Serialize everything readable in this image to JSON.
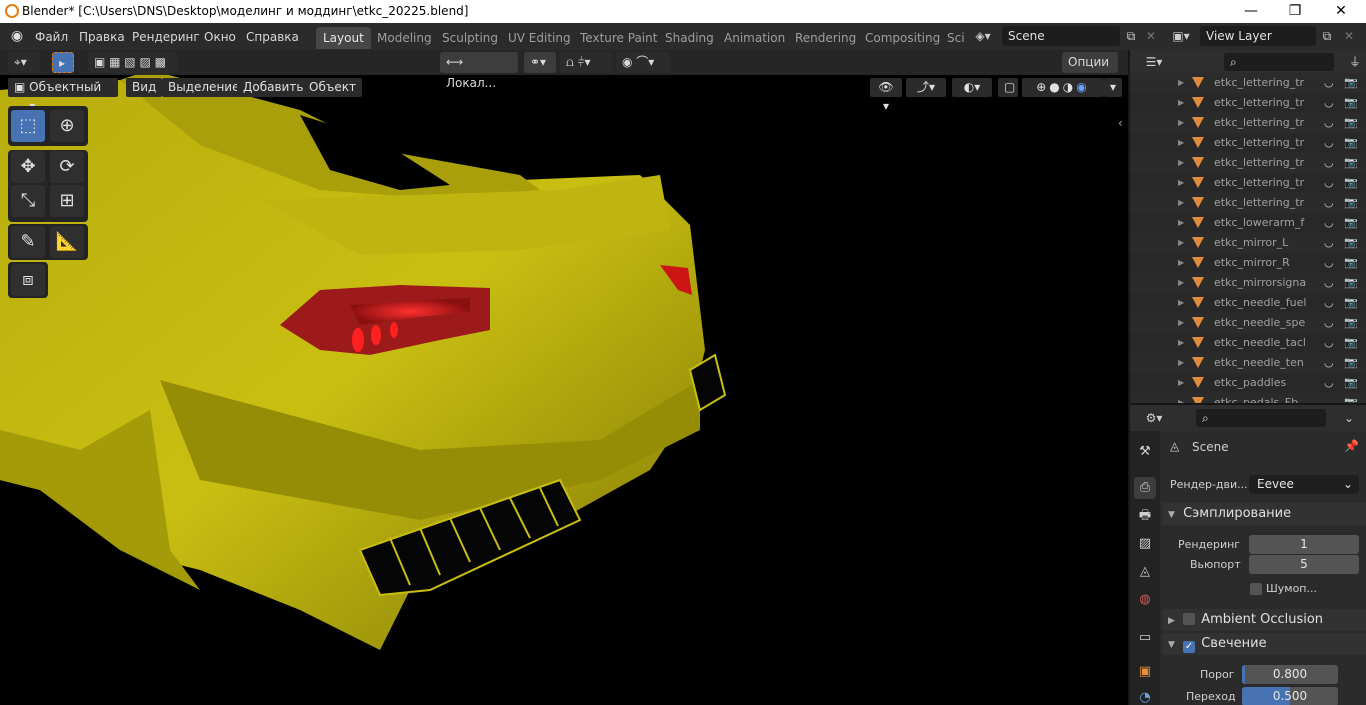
{
  "window": {
    "title": "Blender* [C:\\Users\\DNS\\Desktop\\моделинг и моддинг\\etkc_20225.blend]",
    "minimize": "—",
    "maximize": "❐",
    "close": "✕"
  },
  "menu": {
    "items": [
      "Файл",
      "Правка",
      "Рендеринг",
      "Окно",
      "Справка"
    ]
  },
  "workspaces": {
    "tabs": [
      "Layout",
      "Modeling",
      "Sculpting",
      "UV Editing",
      "Texture Paint",
      "Shading",
      "Animation",
      "Rendering",
      "Compositing",
      "Sci"
    ],
    "active": "Layout"
  },
  "scene": {
    "name": "Scene"
  },
  "view_layer": {
    "name": "View Layer"
  },
  "viewport": {
    "mode": "Объектный ...",
    "menus": [
      "Вид",
      "Выделение",
      "Добавить",
      "Объект"
    ],
    "transform": "Локал...",
    "options": "Опции"
  },
  "outliner": {
    "items": [
      "etkc_lettering_tr",
      "etkc_lettering_tr",
      "etkc_lettering_tr",
      "etkc_lettering_tr",
      "etkc_lettering_tr",
      "etkc_lettering_tr",
      "etkc_lettering_tr",
      "etkc_lowerarm_f",
      "etkc_mirror_L",
      "etkc_mirror_R",
      "etkc_mirrorsigna",
      "etkc_needle_fuel",
      "etkc_needle_spe",
      "etkc_needle_tacl",
      "etkc_needle_ten",
      "etkc_paddles",
      "etkc_pedals_Fb"
    ]
  },
  "properties": {
    "context": "Scene",
    "render_engine_label": "Рендер-дви...",
    "render_engine": "Eevee",
    "sampling": {
      "title": "Сэмплирование",
      "render_label": "Рендеринг",
      "render_value": "1",
      "viewport_label": "Вьюпорт",
      "viewport_value": "5",
      "denoise_label": "Шумоп..."
    },
    "ao": {
      "title": "Ambient Occlusion"
    },
    "bloom": {
      "title": "Свечение",
      "threshold_label": "Порог",
      "threshold_value": "0.800",
      "threshold_fraction": 0.8,
      "knee_label": "Переход",
      "knee_value": "0.500",
      "knee_fraction": 0.5
    }
  },
  "colors": {
    "accent": "#4772b3",
    "car_body": "#c9bf10",
    "taillight": "#ff1a1a"
  }
}
